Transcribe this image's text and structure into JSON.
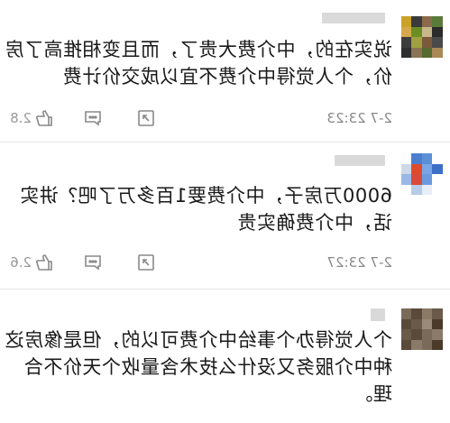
{
  "comments": [
    {
      "text": "说实在的，中介费大贵了，而且变相推高了房价，个人觉得中介费不宜以成交价计费",
      "time": "2-7 23:23",
      "like_count": "2.8",
      "avatar_colors": [
        "#5a7a3a",
        "#8a6a4a",
        "#3a3a3a",
        "#c9a227",
        "#2b2b2b",
        "#c8b78a",
        "#6b8e23",
        "#d4a84b",
        "#4a4a4a",
        "#7a5a3a",
        "#a0a040",
        "#3d3d3d",
        "#aa8855",
        "#556b2f",
        "#8b7355",
        "#2f2f2f"
      ]
    },
    {
      "text": "6000万房子，中介费要1百多万了吧？讲实话，中介费确实贵",
      "time": "2-7 23:27",
      "like_count": "2.6",
      "avatar_colors": [
        "#ffffff",
        "#5b8fd6",
        "#4a7fd0",
        "#ffffff",
        "#3d6fc9",
        "#7aa6e8",
        "#e04a2a",
        "#cfd8e8",
        "#ffffff",
        "#6c9ae0",
        "#d84a3a",
        "#9ab8e6",
        "#ffffff",
        "#e8eef8",
        "#b8cbe8",
        "#ffffff"
      ]
    },
    {
      "text": "个人觉得办个事给中介费可以的，但是像房这种中介服务又没什么技术含量收个天价不合理。",
      "avatar_colors": [
        "#6b5a4a",
        "#8a7a66",
        "#5a4a3a",
        "#7a6a5a",
        "#4a3a2a",
        "#9a8a7a",
        "#6a5a4a",
        "#5a4a3a",
        "#8a7a6a",
        "#7a6a5a",
        "#5a4a3a",
        "#6a5a4a",
        "#4a3a2a",
        "#7a6a5a",
        "#8a7a6a",
        "#5a4a3a"
      ]
    }
  ]
}
